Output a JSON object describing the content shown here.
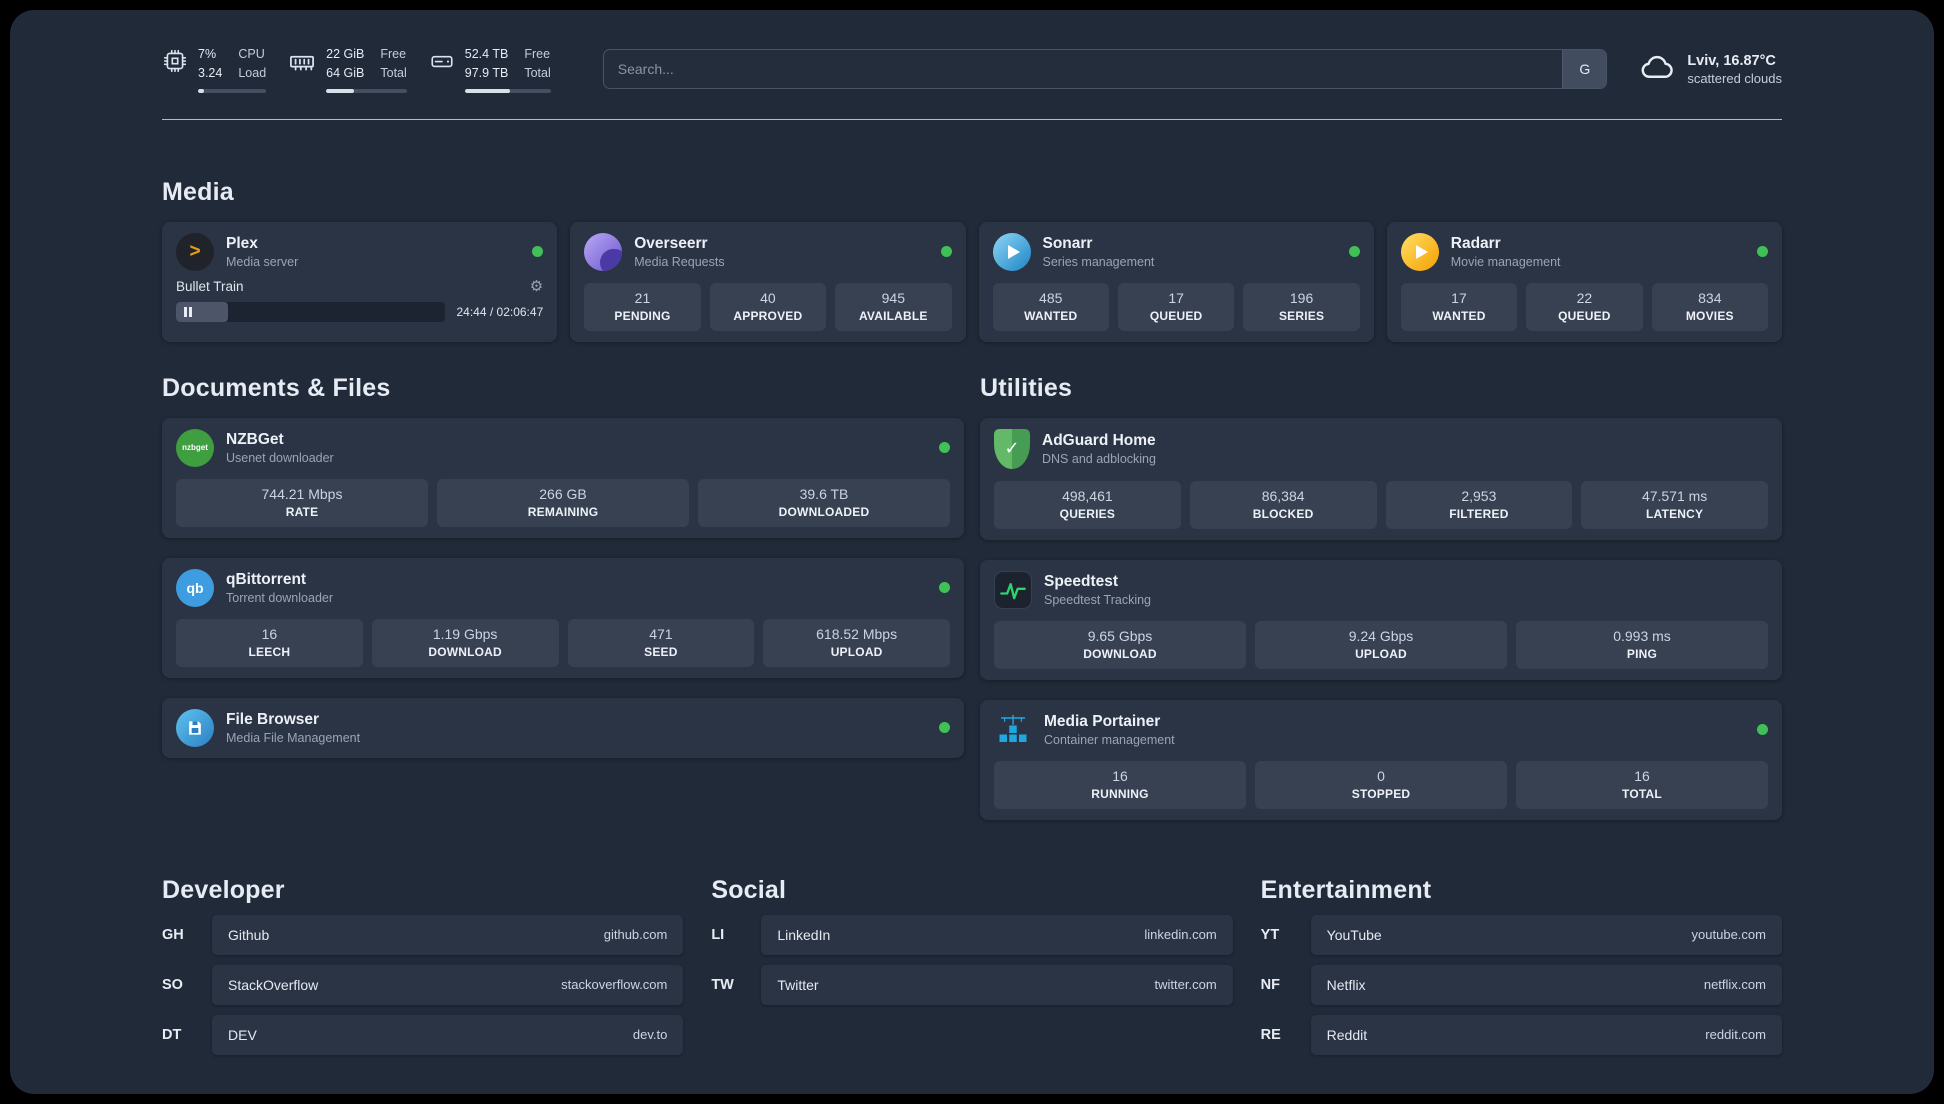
{
  "topbar": {
    "cpu": {
      "line1": "7%",
      "line2": "3.24",
      "label1": "CPU",
      "label2": "Load",
      "progress": 9
    },
    "ram": {
      "line1": "22 GiB",
      "line2": "64 GiB",
      "label1": "Free",
      "label2": "Total",
      "progress": 34
    },
    "disk": {
      "line1": "52.4 TB",
      "line2": "97.9 TB",
      "label1": "Free",
      "label2": "Total",
      "progress": 53
    },
    "search": {
      "placeholder": "Search...",
      "button_label": "G"
    },
    "weather": {
      "location": "Lviv, 16.87°C",
      "condition": "scattered clouds"
    }
  },
  "sections": {
    "media": {
      "title": "Media",
      "apps": [
        {
          "name": "Plex",
          "subtitle": "Media server",
          "icon": "plex-icon",
          "status": true,
          "player": {
            "track": "Bullet Train",
            "time": "24:44 / 02:06:47",
            "progress": 19.5
          }
        },
        {
          "name": "Overseerr",
          "subtitle": "Media Requests",
          "icon": "overseerr-icon",
          "status": true,
          "stats": [
            {
              "value": "21",
              "label": "PENDING"
            },
            {
              "value": "40",
              "label": "APPROVED"
            },
            {
              "value": "945",
              "label": "AVAILABLE"
            }
          ]
        },
        {
          "name": "Sonarr",
          "subtitle": "Series management",
          "icon": "sonarr-icon",
          "status": true,
          "stats": [
            {
              "value": "485",
              "label": "WANTED"
            },
            {
              "value": "17",
              "label": "QUEUED"
            },
            {
              "value": "196",
              "label": "SERIES"
            }
          ]
        },
        {
          "name": "Radarr",
          "subtitle": "Movie management",
          "icon": "radarr-icon",
          "status": true,
          "stats": [
            {
              "value": "17",
              "label": "WANTED"
            },
            {
              "value": "22",
              "label": "QUEUED"
            },
            {
              "value": "834",
              "label": "MOVIES"
            }
          ]
        }
      ]
    },
    "documents": {
      "title": "Documents & Files",
      "apps": [
        {
          "name": "NZBGet",
          "subtitle": "Usenet downloader",
          "icon": "nzbget-icon",
          "icon_text": "nzbget",
          "status": true,
          "stats": [
            {
              "value": "744.21 Mbps",
              "label": "RATE"
            },
            {
              "value": "266 GB",
              "label": "REMAINING"
            },
            {
              "value": "39.6 TB",
              "label": "DOWNLOADED"
            }
          ]
        },
        {
          "name": "qBittorrent",
          "subtitle": "Torrent downloader",
          "icon": "qbittorrent-icon",
          "icon_text": "qb",
          "status": true,
          "stats": [
            {
              "value": "16",
              "label": "LEECH"
            },
            {
              "value": "1.19 Gbps",
              "label": "DOWNLOAD"
            },
            {
              "value": "471",
              "label": "SEED"
            },
            {
              "value": "618.52 Mbps",
              "label": "UPLOAD"
            }
          ]
        },
        {
          "name": "File Browser",
          "subtitle": "Media File Management",
          "icon": "filebrowser-icon",
          "status": true
        }
      ]
    },
    "utilities": {
      "title": "Utilities",
      "apps": [
        {
          "name": "AdGuard Home",
          "subtitle": "DNS and adblocking",
          "icon": "adguard-icon",
          "status": false,
          "stats": [
            {
              "value": "498,461",
              "label": "QUERIES"
            },
            {
              "value": "86,384",
              "label": "BLOCKED"
            },
            {
              "value": "2,953",
              "label": "FILTERED"
            },
            {
              "value": "47.571 ms",
              "label": "LATENCY"
            }
          ]
        },
        {
          "name": "Speedtest",
          "subtitle": "Speedtest Tracking",
          "icon": "speedtest-icon",
          "status": false,
          "stats": [
            {
              "value": "9.65 Gbps",
              "label": "DOWNLOAD"
            },
            {
              "value": "9.24 Gbps",
              "label": "UPLOAD"
            },
            {
              "value": "0.993 ms",
              "label": "PING"
            }
          ]
        },
        {
          "name": "Media Portainer",
          "subtitle": "Container management",
          "icon": "portainer-icon",
          "status": true,
          "stats": [
            {
              "value": "16",
              "label": "RUNNING"
            },
            {
              "value": "0",
              "label": "STOPPED"
            },
            {
              "value": "16",
              "label": "TOTAL"
            }
          ]
        }
      ]
    }
  },
  "bookmarks": [
    {
      "title": "Developer",
      "items": [
        {
          "abbr": "GH",
          "name": "Github",
          "url": "github.com"
        },
        {
          "abbr": "SO",
          "name": "StackOverflow",
          "url": "stackoverflow.com"
        },
        {
          "abbr": "DT",
          "name": "DEV",
          "url": "dev.to"
        }
      ]
    },
    {
      "title": "Social",
      "items": [
        {
          "abbr": "LI",
          "name": "LinkedIn",
          "url": "linkedin.com"
        },
        {
          "abbr": "TW",
          "name": "Twitter",
          "url": "twitter.com"
        }
      ]
    },
    {
      "title": "Entertainment",
      "items": [
        {
          "abbr": "YT",
          "name": "YouTube",
          "url": "youtube.com"
        },
        {
          "abbr": "NF",
          "name": "Netflix",
          "url": "netflix.com"
        },
        {
          "abbr": "RE",
          "name": "Reddit",
          "url": "reddit.com"
        }
      ]
    }
  ],
  "colors": {
    "background": "#212a39",
    "card": "#2b3444",
    "tile": "#374152",
    "status_green": "#40c057",
    "plex_amber": "#e5a00d",
    "divider": "#c3cbd9"
  }
}
